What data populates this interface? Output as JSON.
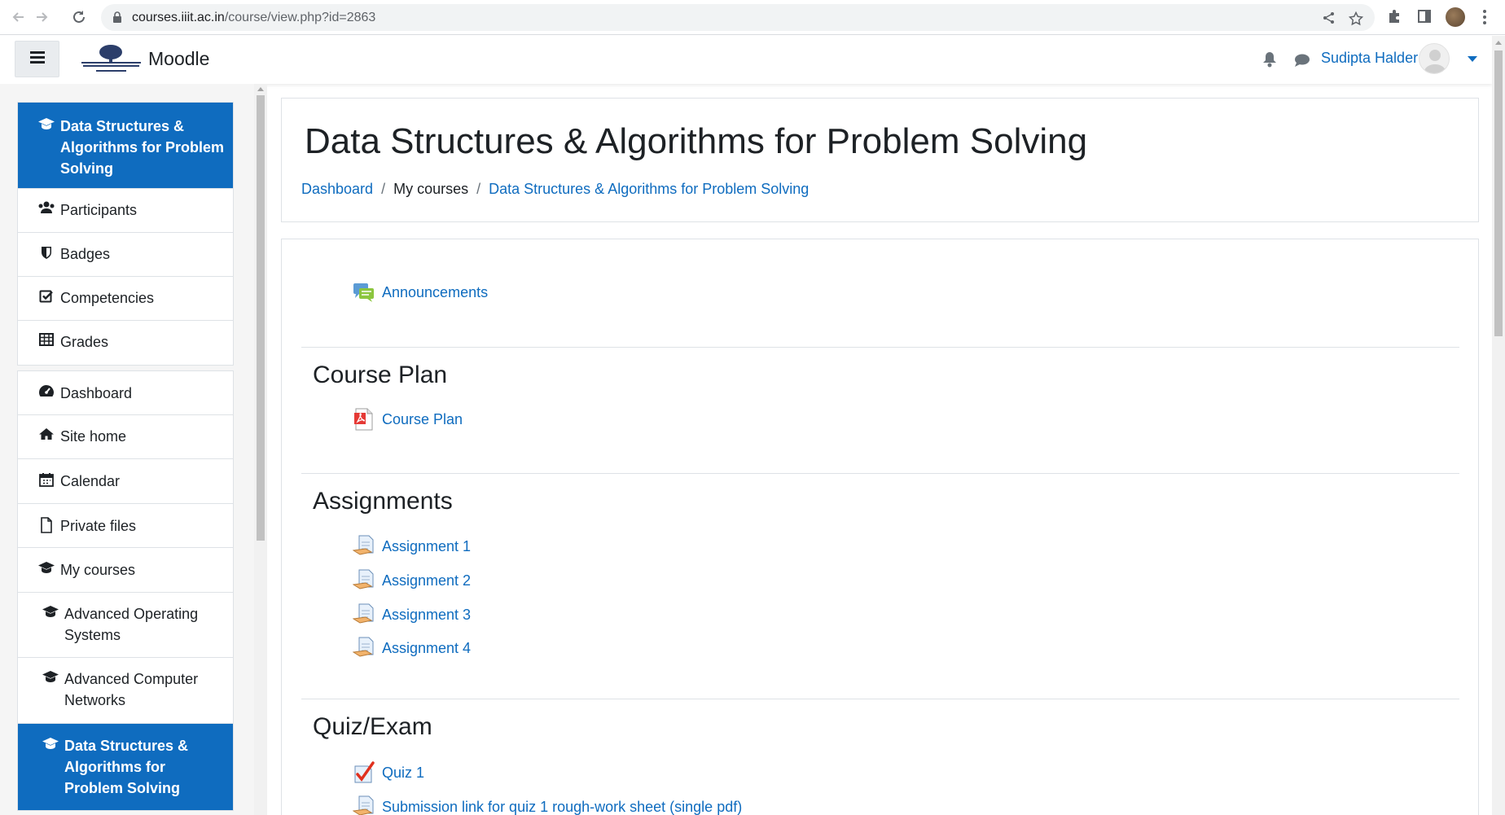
{
  "browser": {
    "url_host": "courses.iiit.ac.in",
    "url_path": "/course/view.php?id=2863"
  },
  "navbar": {
    "brand": "Moodle",
    "user_name": "Sudipta Halder"
  },
  "drawer": {
    "course_items": [
      {
        "label": "Data Structures & Algorithms for Problem Solving",
        "icon": "graduation-cap-icon",
        "active": true
      },
      {
        "label": "Participants",
        "icon": "users-icon"
      },
      {
        "label": "Badges",
        "icon": "shield-icon"
      },
      {
        "label": "Competencies",
        "icon": "check-square-icon"
      },
      {
        "label": "Grades",
        "icon": "table-icon"
      }
    ],
    "site_items": [
      {
        "label": "Dashboard",
        "icon": "tachometer-icon"
      },
      {
        "label": "Site home",
        "icon": "home-icon"
      },
      {
        "label": "Calendar",
        "icon": "calendar-icon"
      },
      {
        "label": "Private files",
        "icon": "file-icon"
      },
      {
        "label": "My courses",
        "icon": "graduation-cap-icon"
      },
      {
        "label": "Advanced Operating Systems",
        "icon": "graduation-cap-icon"
      },
      {
        "label": "Advanced Computer Networks",
        "icon": "graduation-cap-icon"
      },
      {
        "label": "Data Structures & Algorithms for Problem Solving",
        "icon": "graduation-cap-icon",
        "active": true
      }
    ]
  },
  "header": {
    "title": "Data Structures & Algorithms for Problem Solving",
    "breadcrumb": [
      "Dashboard",
      "My courses",
      "Data Structures & Algorithms for Problem Solving"
    ]
  },
  "sections": [
    {
      "title": "",
      "activities": [
        {
          "label": "Announcements",
          "icon": "forum-icon"
        }
      ]
    },
    {
      "title": "Course Plan",
      "activities": [
        {
          "label": "Course Plan",
          "icon": "pdf-icon"
        }
      ]
    },
    {
      "title": "Assignments",
      "activities": [
        {
          "label": "Assignment 1",
          "icon": "assignment-icon"
        },
        {
          "label": "Assignment 2",
          "icon": "assignment-icon"
        },
        {
          "label": "Assignment 3",
          "icon": "assignment-icon"
        },
        {
          "label": "Assignment 4",
          "icon": "assignment-icon"
        }
      ]
    },
    {
      "title": "Quiz/Exam",
      "activities": [
        {
          "label": "Quiz 1",
          "icon": "quiz-icon"
        },
        {
          "label": "Submission link for quiz 1 rough-work sheet (single pdf)",
          "icon": "assignment-icon"
        }
      ]
    }
  ],
  "colors": {
    "link": "#0f6cbf",
    "active_bg": "#0f6cbf",
    "drawer_bg": "#f5f5f5"
  }
}
